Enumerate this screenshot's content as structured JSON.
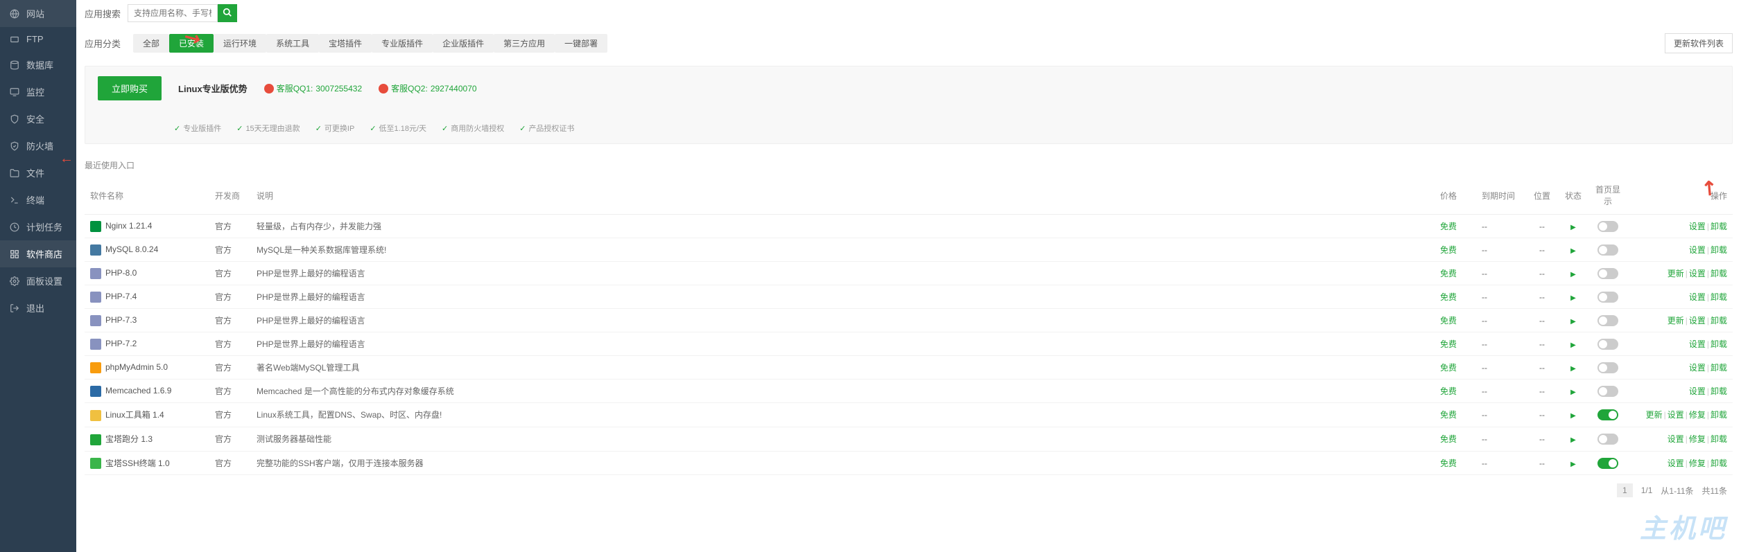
{
  "sidebar": {
    "items": [
      {
        "icon": "globe",
        "label": "网站"
      },
      {
        "icon": "ftp",
        "label": "FTP"
      },
      {
        "icon": "db",
        "label": "数据库"
      },
      {
        "icon": "monitor",
        "label": "监控"
      },
      {
        "icon": "shield",
        "label": "安全"
      },
      {
        "icon": "firewall",
        "label": "防火墙"
      },
      {
        "icon": "folder",
        "label": "文件"
      },
      {
        "icon": "terminal",
        "label": "终端"
      },
      {
        "icon": "task",
        "label": "计划任务"
      },
      {
        "icon": "store",
        "label": "软件商店"
      },
      {
        "icon": "panel",
        "label": "面板设置"
      },
      {
        "icon": "exit",
        "label": "退出"
      }
    ]
  },
  "top": {
    "search_label": "应用搜索",
    "search_placeholder": "支持应用名称、手写极速搜索"
  },
  "categories": {
    "label": "应用分类",
    "items": [
      "全部",
      "已安装",
      "运行环境",
      "系统工具",
      "宝塔插件",
      "专业版插件",
      "企业版插件",
      "第三方应用",
      "一键部署"
    ],
    "refresh": "更新软件列表"
  },
  "promo": {
    "buy": "立即购买",
    "title": "Linux专业版优势",
    "qq1_label": "客服QQ1:",
    "qq1_num": "3007255432",
    "qq2_label": "客服QQ2:",
    "qq2_num": "2927440070",
    "features": [
      "专业版插件",
      "15天无理由退款",
      "可更换IP",
      "低至1.18元/天",
      "商用防火墙授权",
      "产品授权证书"
    ]
  },
  "recent_label": "最近使用入口",
  "table": {
    "headers": {
      "name": "软件名称",
      "dev": "开发商",
      "desc": "说明",
      "price": "价格",
      "expire": "到期时间",
      "pos": "位置",
      "status": "状态",
      "home": "首页显示",
      "op": "操作"
    },
    "rows": [
      {
        "icon": "#00923f",
        "name": "Nginx 1.21.4",
        "dev": "官方",
        "desc": "轻量级，占有内存少，并发能力强",
        "price": "免费",
        "expire": "--",
        "pos": "--",
        "status": "play",
        "home": false,
        "ops": [
          "设置",
          "卸载"
        ]
      },
      {
        "icon": "#4479a1",
        "name": "MySQL 8.0.24",
        "dev": "官方",
        "desc": "MySQL是一种关系数据库管理系统!",
        "price": "免费",
        "expire": "--",
        "pos": "--",
        "status": "play",
        "home": false,
        "ops": [
          "设置",
          "卸载"
        ]
      },
      {
        "icon": "#8892bf",
        "name": "PHP-8.0",
        "dev": "官方",
        "desc": "PHP是世界上最好的编程语言",
        "price": "免费",
        "expire": "--",
        "pos": "--",
        "status": "play",
        "home": false,
        "ops": [
          "更新",
          "设置",
          "卸载"
        ]
      },
      {
        "icon": "#8892bf",
        "name": "PHP-7.4",
        "dev": "官方",
        "desc": "PHP是世界上最好的编程语言",
        "price": "免费",
        "expire": "--",
        "pos": "--",
        "status": "play",
        "home": false,
        "ops": [
          "设置",
          "卸载"
        ]
      },
      {
        "icon": "#8892bf",
        "name": "PHP-7.3",
        "dev": "官方",
        "desc": "PHP是世界上最好的编程语言",
        "price": "免费",
        "expire": "--",
        "pos": "--",
        "status": "play",
        "home": false,
        "ops": [
          "更新",
          "设置",
          "卸载"
        ]
      },
      {
        "icon": "#8892bf",
        "name": "PHP-7.2",
        "dev": "官方",
        "desc": "PHP是世界上最好的编程语言",
        "price": "免费",
        "expire": "--",
        "pos": "--",
        "status": "play",
        "home": false,
        "ops": [
          "设置",
          "卸载"
        ]
      },
      {
        "icon": "#f89c0e",
        "name": "phpMyAdmin 5.0",
        "dev": "官方",
        "desc": "著名Web端MySQL管理工具",
        "price": "免费",
        "expire": "--",
        "pos": "--",
        "status": "play",
        "home": false,
        "ops": [
          "设置",
          "卸载"
        ]
      },
      {
        "icon": "#2b6aa5",
        "name": "Memcached 1.6.9",
        "dev": "官方",
        "desc": "Memcached 是一个高性能的分布式内存对象缓存系统",
        "price": "免费",
        "expire": "--",
        "pos": "--",
        "status": "play",
        "home": false,
        "ops": [
          "设置",
          "卸载"
        ]
      },
      {
        "icon": "#f0c040",
        "name": "Linux工具箱 1.4",
        "dev": "官方",
        "desc": "Linux系统工具，配置DNS、Swap、时区、内存盘!",
        "price": "免费",
        "expire": "--",
        "pos": "--",
        "status": "play",
        "home": true,
        "ops": [
          "更新",
          "设置",
          "修复",
          "卸载"
        ]
      },
      {
        "icon": "#20a53a",
        "name": "宝塔跑分 1.3",
        "dev": "官方",
        "desc": "测试服务器基础性能",
        "price": "免费",
        "expire": "--",
        "pos": "--",
        "status": "play",
        "home": false,
        "ops": [
          "设置",
          "修复",
          "卸载"
        ]
      },
      {
        "icon": "#3ab54a",
        "name": "宝塔SSH终端 1.0",
        "dev": "官方",
        "desc": "完整功能的SSH客户端，仅用于连接本服务器",
        "price": "免费",
        "expire": "--",
        "pos": "--",
        "status": "play",
        "home": true,
        "ops": [
          "设置",
          "修复",
          "卸载"
        ]
      }
    ]
  },
  "pagination": {
    "page": "1",
    "pages": "1/1",
    "range": "从1-11条",
    "total": "共11条"
  },
  "watermark": "主机吧"
}
